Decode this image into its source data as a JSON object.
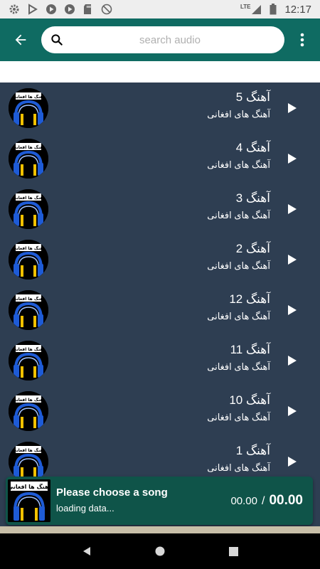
{
  "status_bar": {
    "time": "12:17",
    "network": "LTE",
    "left_icons": [
      "settings-icon",
      "play-store-icon",
      "play-circle-icon",
      "play-circle-icon",
      "sd-card-icon",
      "blocked-icon"
    ]
  },
  "app_bar": {
    "search_placeholder": "search audio",
    "back_icon": "arrow-back-icon",
    "menu_icon": "more-vert-icon"
  },
  "songs": [
    {
      "title": "آهنگ 5",
      "subtitle": "آهنگ های افغانی"
    },
    {
      "title": "آهنگ 4",
      "subtitle": "آهنگ های افغانی"
    },
    {
      "title": "آهنگ 3",
      "subtitle": "آهنگ های افغانی"
    },
    {
      "title": "آهنگ 2",
      "subtitle": "آهنگ های افغانی"
    },
    {
      "title": "آهنگ 12",
      "subtitle": "آهنگ های افغانی"
    },
    {
      "title": "آهنگ 11",
      "subtitle": "آهنگ های افغانی"
    },
    {
      "title": "آهنگ 10",
      "subtitle": "آهنگ های افغانی"
    },
    {
      "title": "آهنگ 1",
      "subtitle": "آهنگ های افغانی"
    }
  ],
  "thumbnail_text": "آهنگ ها افغانی",
  "player": {
    "title": "Please choose a song",
    "status": "loading data...",
    "current_time": "00.00",
    "separator": "/",
    "duration": "00.00"
  },
  "colors": {
    "app_bar": "#0f6b62",
    "list_bg": "#2e3e52",
    "player_bg": "#0f5449",
    "headphone_blue": "#1e5bd6",
    "headphone_yellow": "#f2c200"
  }
}
